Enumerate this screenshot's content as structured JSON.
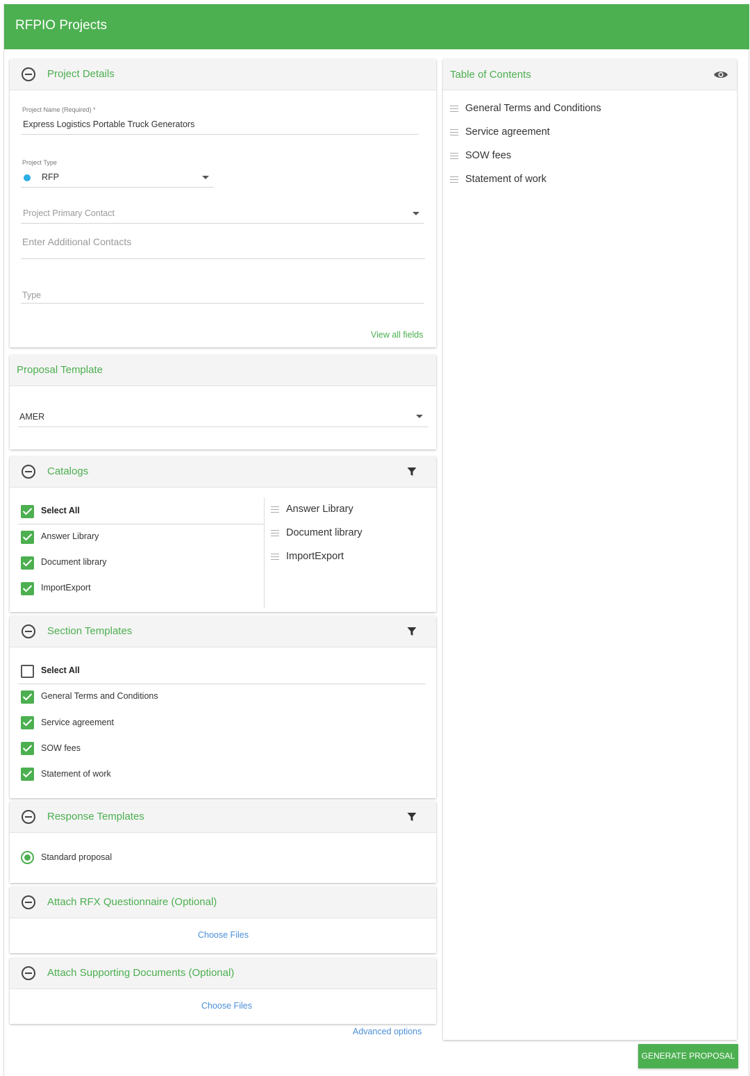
{
  "app": {
    "title": "RFPIO Projects"
  },
  "project_details": {
    "title": "Project Details",
    "project_name_label": "Project Name (Required) *",
    "project_name_value": "Express Logistics Portable Truck Generators",
    "project_type_label": "Project Type",
    "project_type_value": "RFP",
    "primary_contact_placeholder": "Project Primary Contact",
    "additional_contacts_placeholder": "Enter Additional Contacts",
    "type_placeholder": "Type",
    "view_all_fields": "View all fields"
  },
  "proposal_template": {
    "title": "Proposal Template",
    "value": "AMER"
  },
  "catalogs": {
    "title": "Catalogs",
    "select_all": "Select All",
    "items": [
      "Answer Library",
      "Document library",
      "ImportExport"
    ],
    "order": [
      "Answer Library",
      "Document library",
      "ImportExport"
    ]
  },
  "section_templates": {
    "title": "Section Templates",
    "select_all": "Select All",
    "items": [
      "General Terms and Conditions",
      "Service agreement",
      "SOW fees",
      "Statement of work"
    ]
  },
  "response_templates": {
    "title": "Response Templates",
    "selected": "Standard proposal"
  },
  "attach_rfx": {
    "title": "Attach RFX Questionnaire (Optional)",
    "button": "Choose Files"
  },
  "attach_docs": {
    "title": "Attach Supporting Documents (Optional)",
    "button": "Choose Files"
  },
  "advanced_options": "Advanced options",
  "toc": {
    "title": "Table of Contents",
    "items": [
      "General Terms and Conditions",
      "Service agreement",
      "SOW fees",
      "Statement of work"
    ]
  },
  "generate_button": "GENERATE PROPOSAL",
  "colors": {
    "accent": "#4cb050",
    "link": "#4b8fd8"
  },
  "icons": [
    "collapse-icon",
    "filter-icon",
    "eye-icon",
    "drag-handle-icon",
    "check-icon",
    "chevron-down-icon"
  ]
}
